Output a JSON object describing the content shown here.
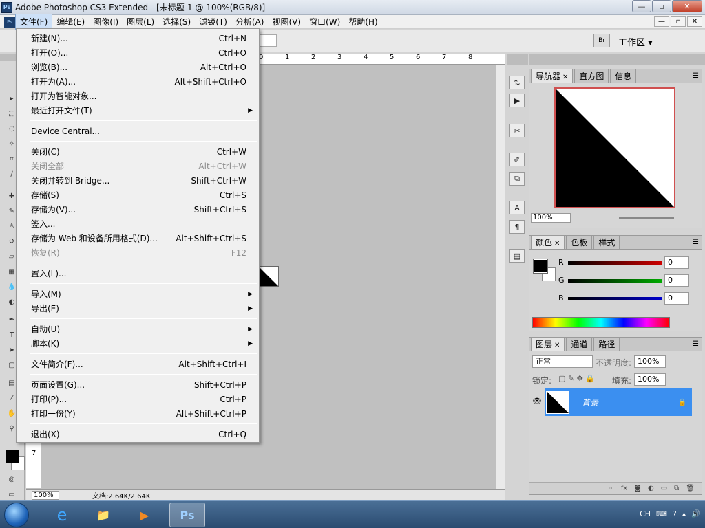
{
  "window": {
    "title": "Adobe Photoshop CS3 Extended - [未标题-1 @ 100%(RGB/8)]",
    "app_icon": "Ps",
    "controls": [
      "—",
      "▫",
      "✕"
    ]
  },
  "menubar": {
    "items": [
      "文件(F)",
      "编辑(E)",
      "图像(I)",
      "图层(L)",
      "选择(S)",
      "滤镜(T)",
      "分析(A)",
      "视图(V)",
      "窗口(W)",
      "帮助(H)"
    ],
    "active_index": 0,
    "mdi_controls": [
      "—",
      "▫",
      "✕"
    ]
  },
  "options": {
    "field_value": "...",
    "bridge_label": "Br",
    "workspace_label": "工作区 ▾"
  },
  "file_menu": [
    {
      "label": "新建(N)...",
      "shortcut": "Ctrl+N"
    },
    {
      "label": "打开(O)...",
      "shortcut": "Ctrl+O"
    },
    {
      "label": "浏览(B)...",
      "shortcut": "Alt+Ctrl+O"
    },
    {
      "label": "打开为(A)...",
      "shortcut": "Alt+Shift+Ctrl+O"
    },
    {
      "label": "打开为智能对象...",
      "shortcut": ""
    },
    {
      "label": "最近打开文件(T)",
      "shortcut": "",
      "submenu": true
    },
    {
      "sep": true
    },
    {
      "label": "Device Central...",
      "shortcut": ""
    },
    {
      "sep": true
    },
    {
      "label": "关闭(C)",
      "shortcut": "Ctrl+W"
    },
    {
      "label": "关闭全部",
      "shortcut": "Alt+Ctrl+W",
      "disabled": true
    },
    {
      "label": "关闭并转到 Bridge...",
      "shortcut": "Shift+Ctrl+W"
    },
    {
      "label": "存储(S)",
      "shortcut": "Ctrl+S"
    },
    {
      "label": "存储为(V)...",
      "shortcut": "Shift+Ctrl+S"
    },
    {
      "label": "签入...",
      "shortcut": ""
    },
    {
      "label": "存储为 Web 和设备所用格式(D)...",
      "shortcut": "Alt+Shift+Ctrl+S"
    },
    {
      "label": "恢复(R)",
      "shortcut": "F12",
      "disabled": true
    },
    {
      "sep": true
    },
    {
      "label": "置入(L)...",
      "shortcut": ""
    },
    {
      "sep": true
    },
    {
      "label": "导入(M)",
      "shortcut": "",
      "submenu": true
    },
    {
      "label": "导出(E)",
      "shortcut": "",
      "submenu": true
    },
    {
      "sep": true
    },
    {
      "label": "自动(U)",
      "shortcut": "",
      "submenu": true
    },
    {
      "label": "脚本(K)",
      "shortcut": "",
      "submenu": true
    },
    {
      "sep": true
    },
    {
      "label": "文件简介(F)...",
      "shortcut": "Alt+Shift+Ctrl+I"
    },
    {
      "sep": true
    },
    {
      "label": "页面设置(G)...",
      "shortcut": "Shift+Ctrl+P"
    },
    {
      "label": "打印(P)...",
      "shortcut": "Ctrl+P"
    },
    {
      "label": "打印一份(Y)",
      "shortcut": "Alt+Shift+Ctrl+P"
    },
    {
      "sep": true
    },
    {
      "label": "退出(X)",
      "shortcut": "Ctrl+Q"
    }
  ],
  "document": {
    "ruler_numbers": [
      "0",
      "1",
      "2",
      "3",
      "4",
      "5",
      "6",
      "7",
      "8"
    ],
    "left_ruler_number": "7",
    "zoom": "100%",
    "doc_info": "文档:2.64K/2.64K"
  },
  "navigator": {
    "tabs": [
      "导航器",
      "直方图",
      "信息"
    ],
    "zoom": "100%"
  },
  "color": {
    "tabs": [
      "颜色",
      "色板",
      "样式"
    ],
    "channels": [
      {
        "label": "R",
        "value": "0",
        "color": "#cc0000"
      },
      {
        "label": "G",
        "value": "0",
        "color": "#00aa00"
      },
      {
        "label": "B",
        "value": "0",
        "color": "#0000cc"
      }
    ]
  },
  "layers": {
    "tabs": [
      "图层",
      "通道",
      "路径"
    ],
    "blend_mode": "正常",
    "opacity_label": "不透明度:",
    "opacity": "100%",
    "lock_label": "锁定:",
    "fill_label": "填充:",
    "fill": "100%",
    "layer_name": "背景"
  },
  "taskbar": {
    "tray_lang": "CH",
    "active_app": "Ps"
  }
}
